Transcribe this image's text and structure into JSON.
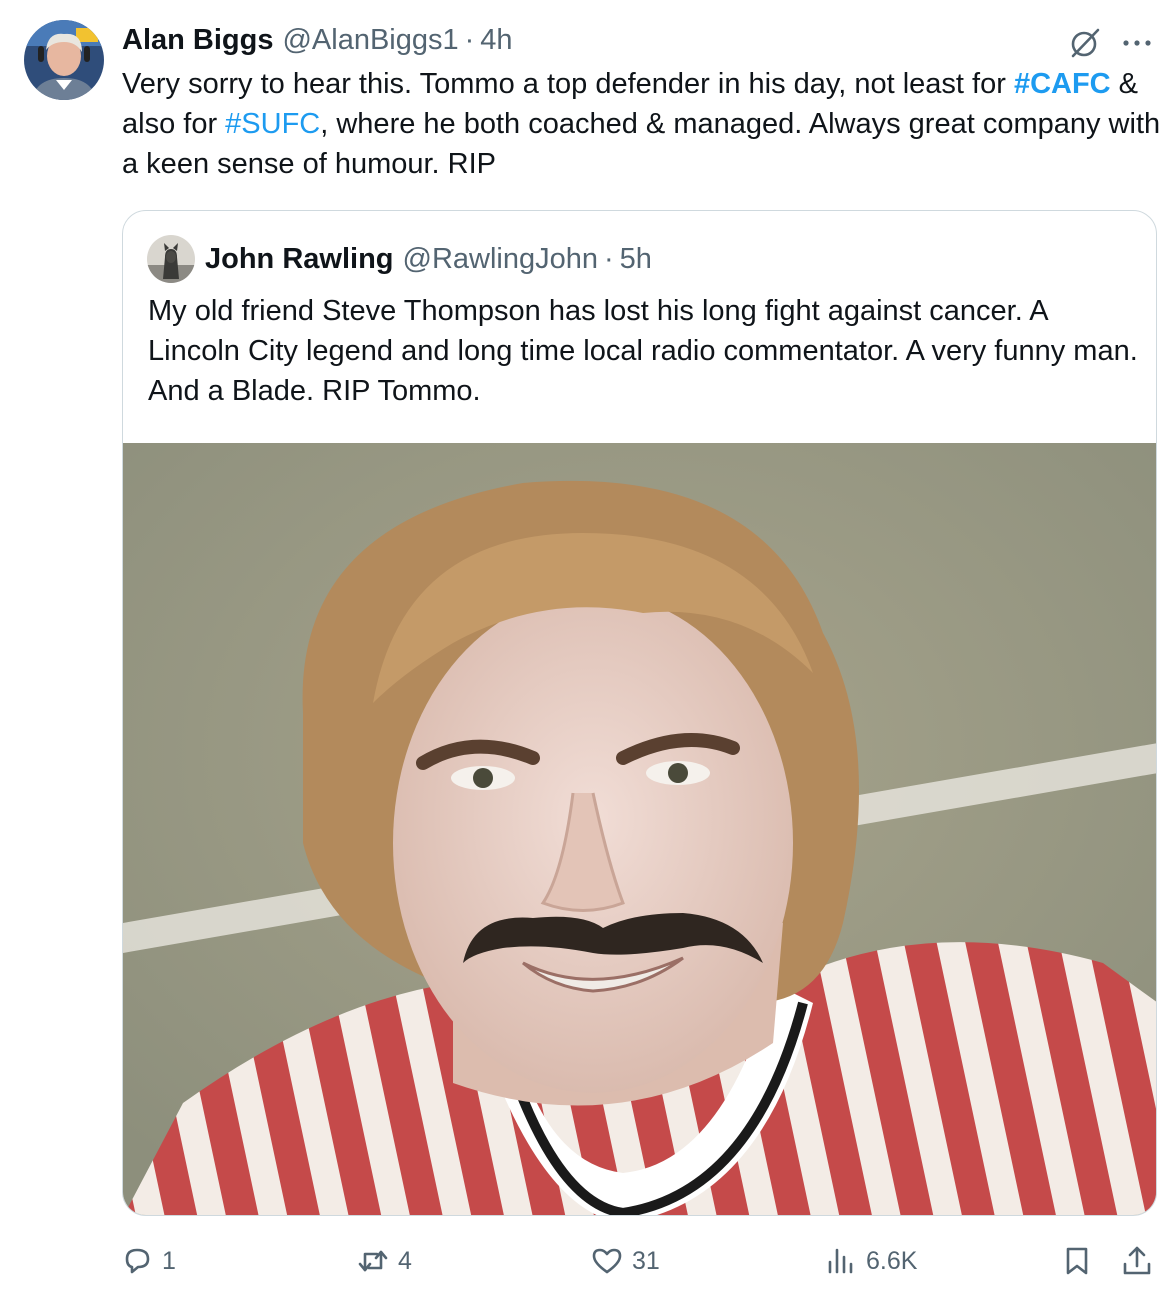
{
  "tweet": {
    "display_name": "Alan Biggs",
    "handle": "@AlanBiggs1",
    "separator": "·",
    "time": "4h",
    "text_part1": "Very sorry to hear this. Tommo a top defender in his day, not least for ",
    "hashtag1": "#CAFC",
    "text_part2": " & also for ",
    "hashtag2": "#SUFC",
    "text_part3": ", where he both coached & managed. Always great company with a keen sense of humour. RIP",
    "avatar_icon": "profile-photo",
    "grok_icon": "grok-icon",
    "more_icon": "more-dots-icon"
  },
  "quoted": {
    "display_name": "John Rawling",
    "handle": "@RawlingJohn",
    "separator": "·",
    "time": "5h",
    "text": "My old friend Steve Thompson has lost his long fight against cancer. A Lincoln City legend and long time local radio commentator. A very funny man. And a Blade. RIP Tommo.",
    "avatar_icon": "dog-profile-photo",
    "media_description_icon": "footballer-photo"
  },
  "actions": {
    "replies": "1",
    "reposts": "4",
    "likes": "31",
    "views": "6.6K"
  },
  "colors": {
    "text": "#0f1419",
    "secondary": "#536471",
    "link": "#1d9bf0",
    "border": "#cfd9de"
  }
}
